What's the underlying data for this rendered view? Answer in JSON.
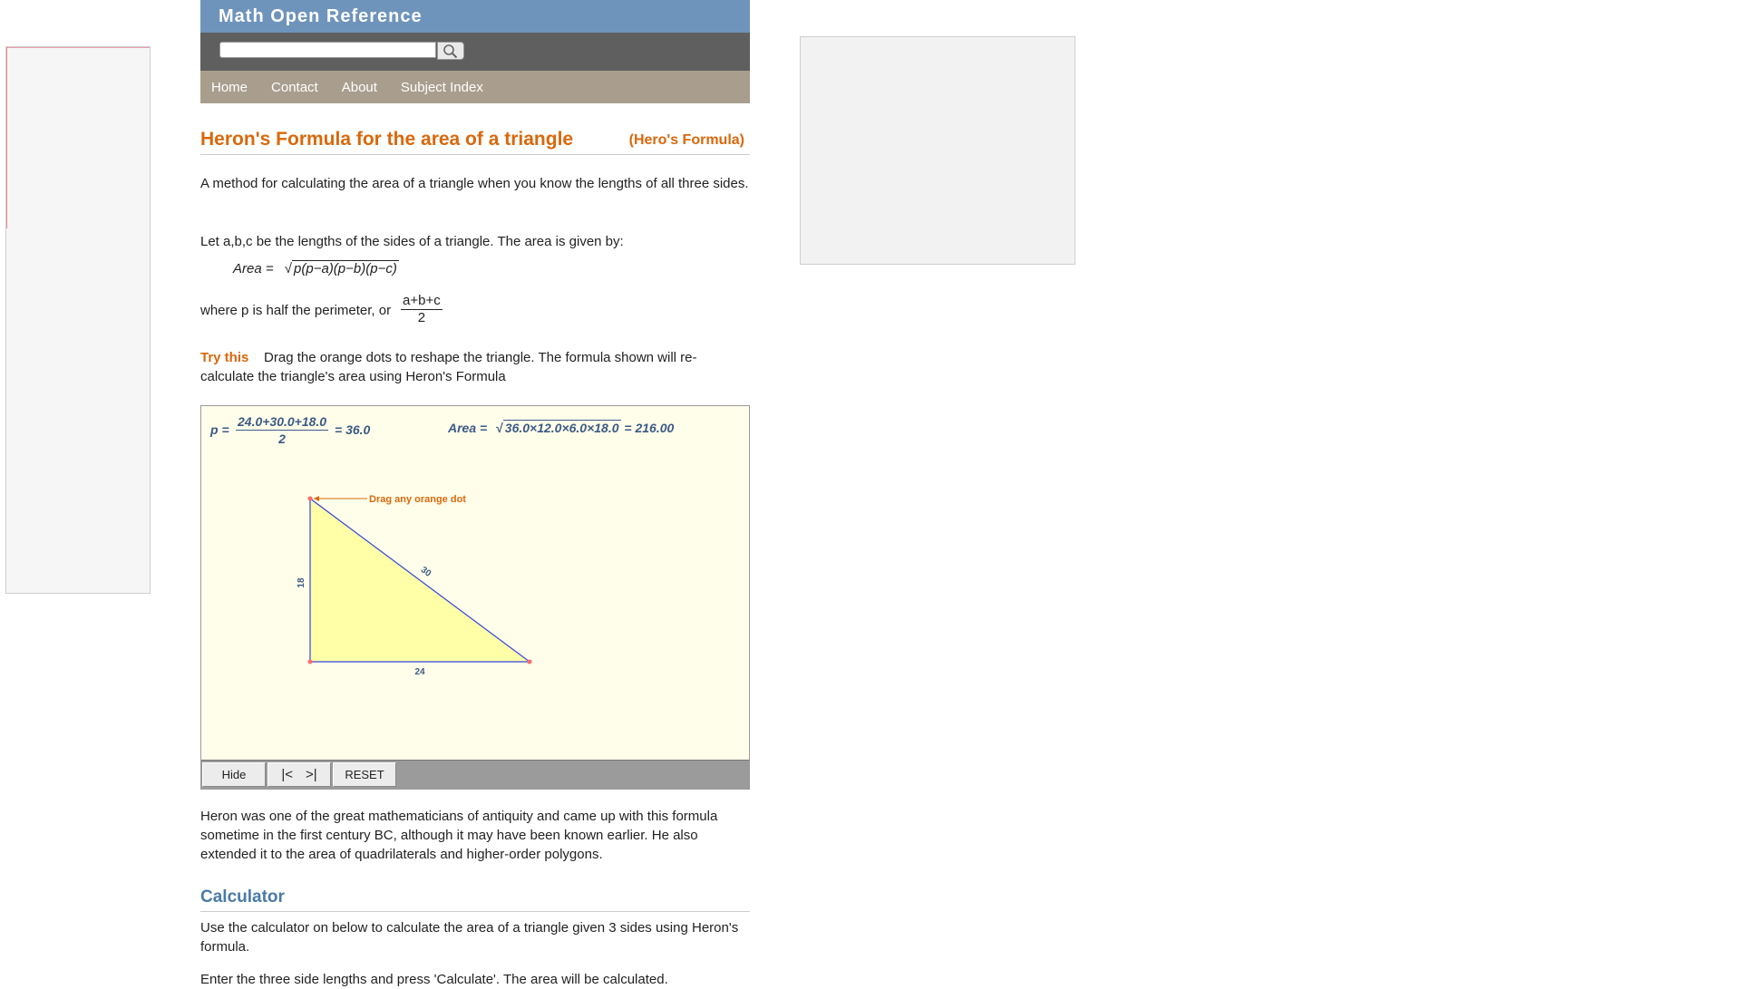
{
  "site": {
    "title": "Math Open Reference"
  },
  "nav": {
    "items": [
      "Home",
      "Contact",
      "About",
      "Subject Index"
    ]
  },
  "page": {
    "title": "Heron's Formula for the area of a triangle",
    "subtitle": "(Hero's Formula)",
    "intro": "A method for calculating the area of a triangle when you know the lengths of all three sides.",
    "let_text": "Let a,b,c be the lengths of the sides of a triangle. The area is given by:",
    "formula_label": "Area =",
    "formula_radicand": "p(p−a)(p−b)(p−c)",
    "perimeter_text": "where p is half the perimeter, or",
    "perimeter_num": "a+b+c",
    "perimeter_den": "2",
    "try_label": "Try this",
    "try_text": "Drag the orange dots to reshape the triangle. The formula shown will re-calculate the triangle's area using Heron's Formula",
    "history": "Heron was one of the great mathematicians of antiquity and came up with this formula sometime in the first century BC, although it may have been known earlier. He also extended it to the area of quadrilaterals and higher-order polygons.",
    "calc_heading": "Calculator",
    "calc_text": "Use the calculator on below to calculate the area of a triangle given 3 sides using Heron's formula.",
    "calc_instructions": "Enter the three side lengths and press 'Calculate'. The area will be calculated."
  },
  "applet": {
    "p_label": "p =",
    "p_num": "24.0+30.0+18.0",
    "p_den": "2",
    "p_result": "= 36.0",
    "area_label": "Area =",
    "area_radicand": "36.0×12.0×6.0×18.0",
    "area_result": "= 216.00",
    "drag_hint": "Drag any orange dot",
    "side_left": "18",
    "side_hyp": "30",
    "side_bottom": "24",
    "buttons": {
      "hide": "Hide",
      "first": "|<",
      "next": ">|",
      "reset": "RESET"
    }
  },
  "colors": {
    "accent_orange": "#d9680c",
    "header_blue": "#6e94bb",
    "nav_tan": "#a99e8e",
    "triangle_fill": "#ffffa8",
    "triangle_stroke": "#3344dd"
  }
}
